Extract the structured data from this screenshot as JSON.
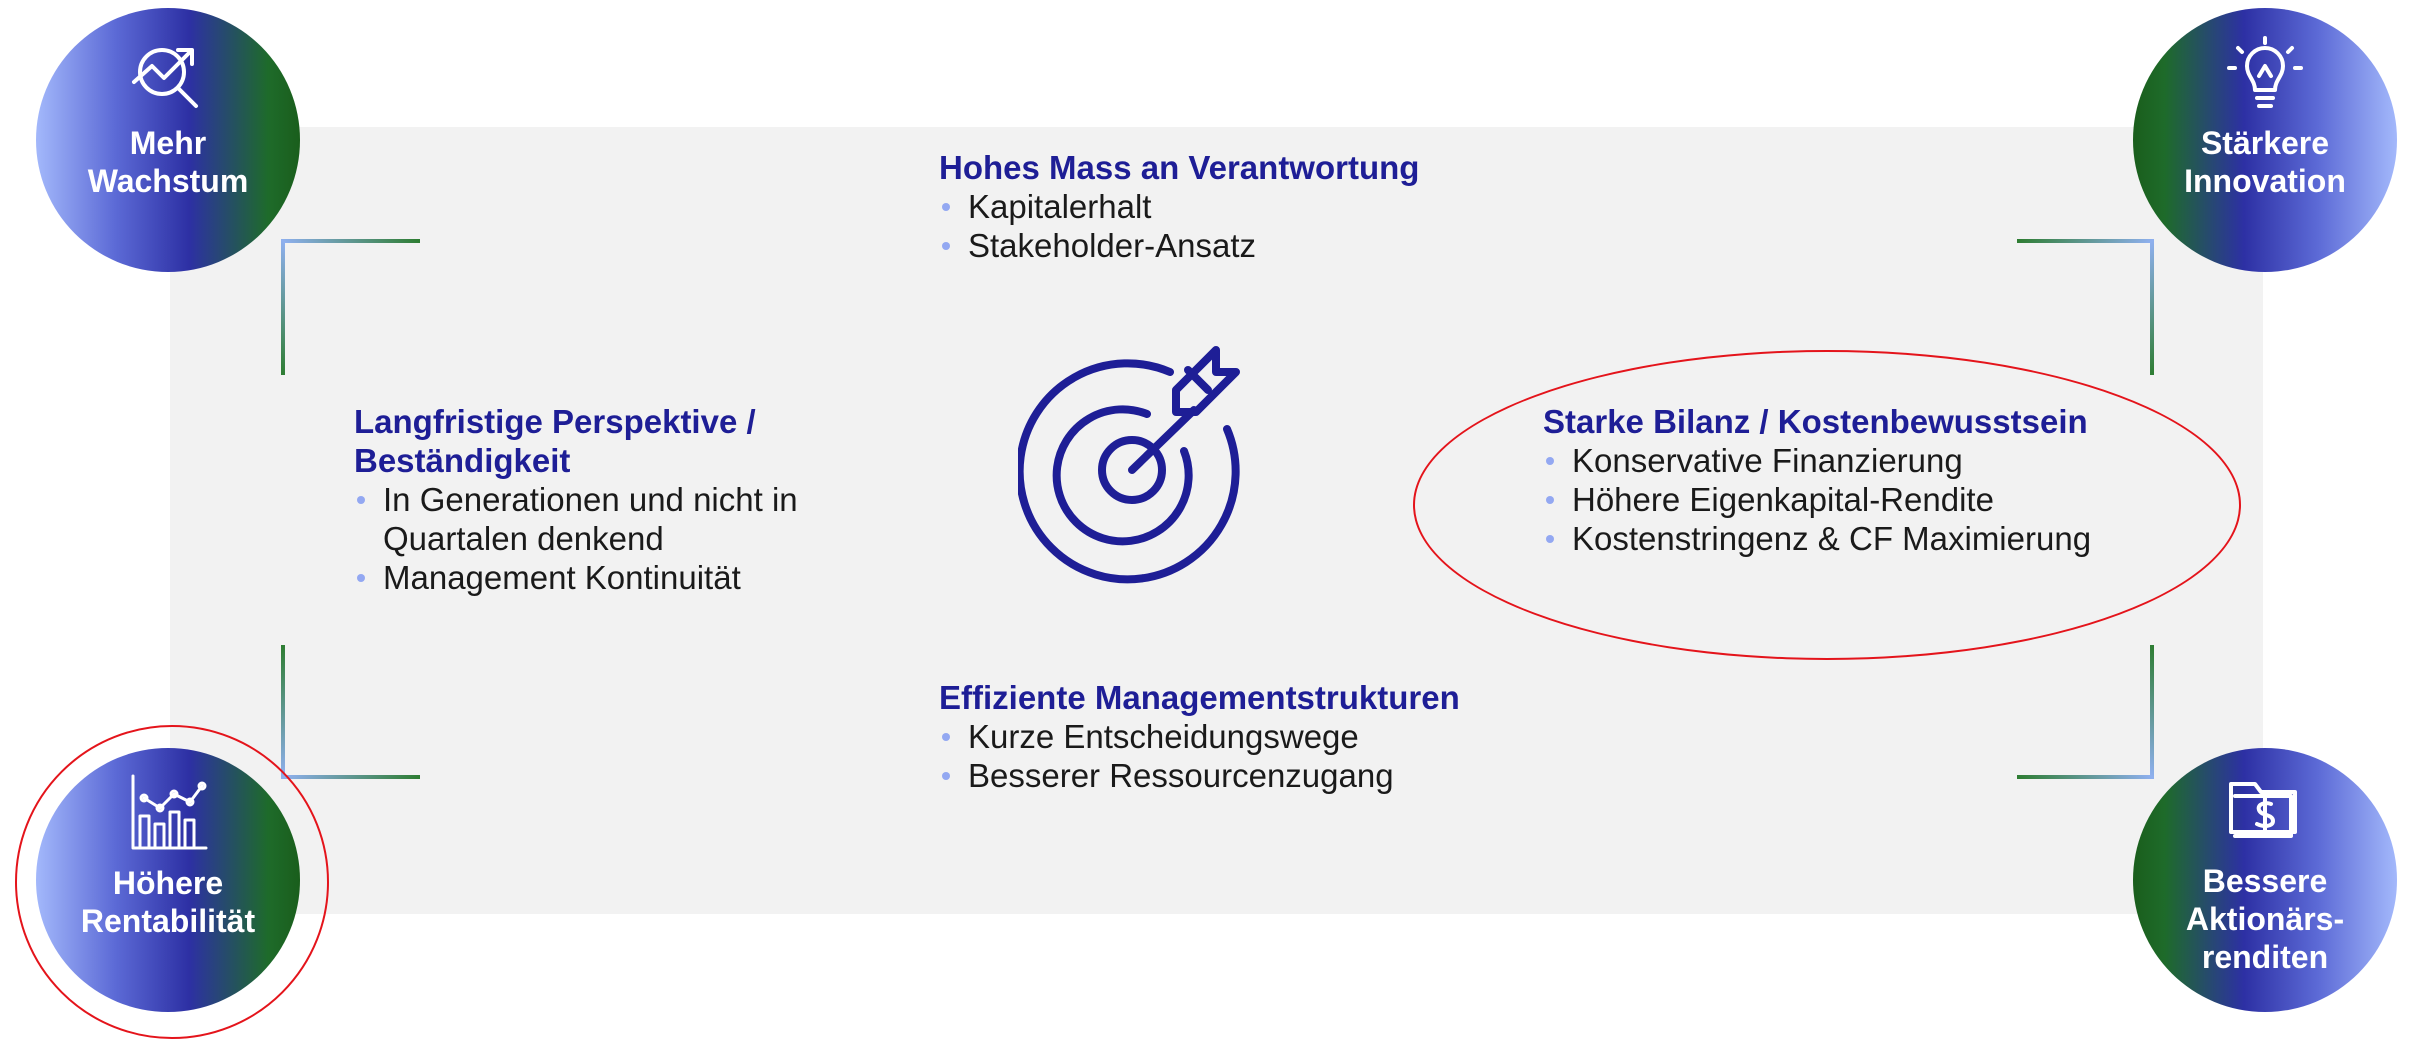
{
  "center_sections": {
    "top": {
      "title": "Hohes Mass an Verantwortung",
      "bullets": [
        "Kapitalerhalt",
        "Stakeholder-Ansatz"
      ]
    },
    "left": {
      "title": "Langfristige Perspektive / Beständigkeit",
      "bullets": [
        "In Generationen und nicht in Quartalen denkend",
        "Management Kontinuität"
      ]
    },
    "right": {
      "title": "Starke Bilanz / Kostenbewusstsein",
      "bullets": [
        "Konservative Finanzierung",
        "Höhere Eigenkapital-Rendite",
        "Kostenstringenz & CF Maximierung"
      ]
    },
    "bottom": {
      "title": "Effiziente Managementstrukturen",
      "bullets": [
        "Kurze Entscheidungswege",
        "Besserer Ressourcenzugang"
      ]
    }
  },
  "corner_circles": {
    "top_left": {
      "label": "Mehr\nWachstum",
      "icon": "growth-magnifier-icon"
    },
    "top_right": {
      "label": "Stärkere\nInnovation",
      "icon": "lightbulb-icon"
    },
    "bottom_left": {
      "label": "Höhere\nRentabilität",
      "icon": "bar-line-chart-icon"
    },
    "bottom_right": {
      "label": "Bessere\nAktionärs-\nrenditen",
      "icon": "dollar-folder-icon"
    }
  },
  "center_icon": "target-arrow-icon",
  "colors": {
    "title": "#1e1e96",
    "bullet": "#93a8f2",
    "highlight_ring": "#e4141b",
    "panel_background": "#f2f2f2"
  }
}
